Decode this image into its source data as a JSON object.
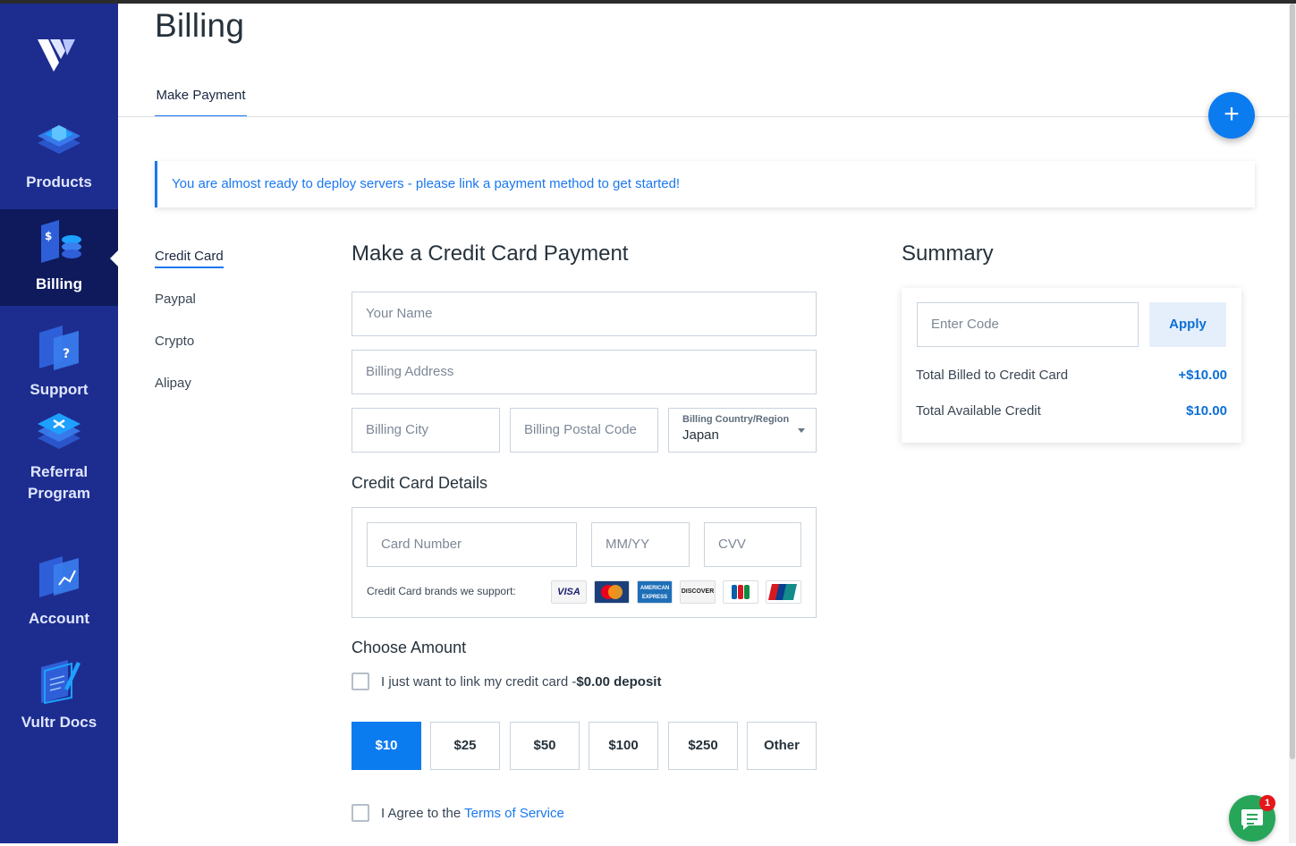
{
  "sidebar": {
    "logo_icon": "vultr-logo-icon",
    "items": [
      {
        "label": "Products",
        "icon": "products-icon"
      },
      {
        "label": "Billing",
        "icon": "billing-icon",
        "active": true
      },
      {
        "label": "Support",
        "icon": "support-icon"
      },
      {
        "label": "Referral Program",
        "icon": "referral-icon"
      },
      {
        "label": "Account",
        "icon": "account-icon"
      },
      {
        "label": "Vultr Docs",
        "icon": "docs-icon"
      }
    ]
  },
  "header": {
    "title": "Billing",
    "tabs": [
      {
        "label": "Make Payment",
        "active": true
      }
    ],
    "fab_icon": "plus-icon"
  },
  "notice": "You are almost ready to deploy servers - please link a payment method to get started!",
  "methods": [
    {
      "label": "Credit Card",
      "active": true
    },
    {
      "label": "Paypal"
    },
    {
      "label": "Crypto"
    },
    {
      "label": "Alipay"
    }
  ],
  "payment": {
    "title": "Make a Credit Card Payment",
    "name_placeholder": "Your Name",
    "address_placeholder": "Billing Address",
    "city_placeholder": "Billing City",
    "postal_placeholder": "Billing Postal Code",
    "country_label": "Billing Country/Region",
    "country_value": "Japan",
    "cc_title": "Credit Card Details",
    "card_number_placeholder": "Card Number",
    "expiry_placeholder": "MM/YY",
    "cvv_placeholder": "CVV",
    "brands_text": "Credit Card brands we support:",
    "brands": [
      "VISA",
      "MasterCard",
      "AMERICAN EXPRESS",
      "DISCOVER",
      "JCB",
      "UnionPay"
    ],
    "amount_title": "Choose Amount",
    "link_only_prefix": "I just want to link my credit card -",
    "link_only_bold": "$0.00 deposit",
    "amounts": [
      {
        "label": "$10",
        "active": true
      },
      {
        "label": "$25"
      },
      {
        "label": "$50"
      },
      {
        "label": "$100"
      },
      {
        "label": "$250"
      },
      {
        "label": "Other"
      }
    ],
    "agree_prefix": "I Agree to the ",
    "agree_link": "Terms of Service"
  },
  "summary": {
    "title": "Summary",
    "code_placeholder": "Enter Code",
    "apply_label": "Apply",
    "rows": [
      {
        "label": "Total Billed to Credit Card",
        "value": "+$10.00"
      },
      {
        "label": "Total Available Credit",
        "value": "$10.00"
      }
    ]
  },
  "chat": {
    "icon": "chat-icon",
    "badge": "1"
  },
  "colors": {
    "sidebar": "#1d2d8f",
    "sidebar_active": "#0e1a5c",
    "accent": "#0b7bf0",
    "chat": "#27a65a"
  }
}
